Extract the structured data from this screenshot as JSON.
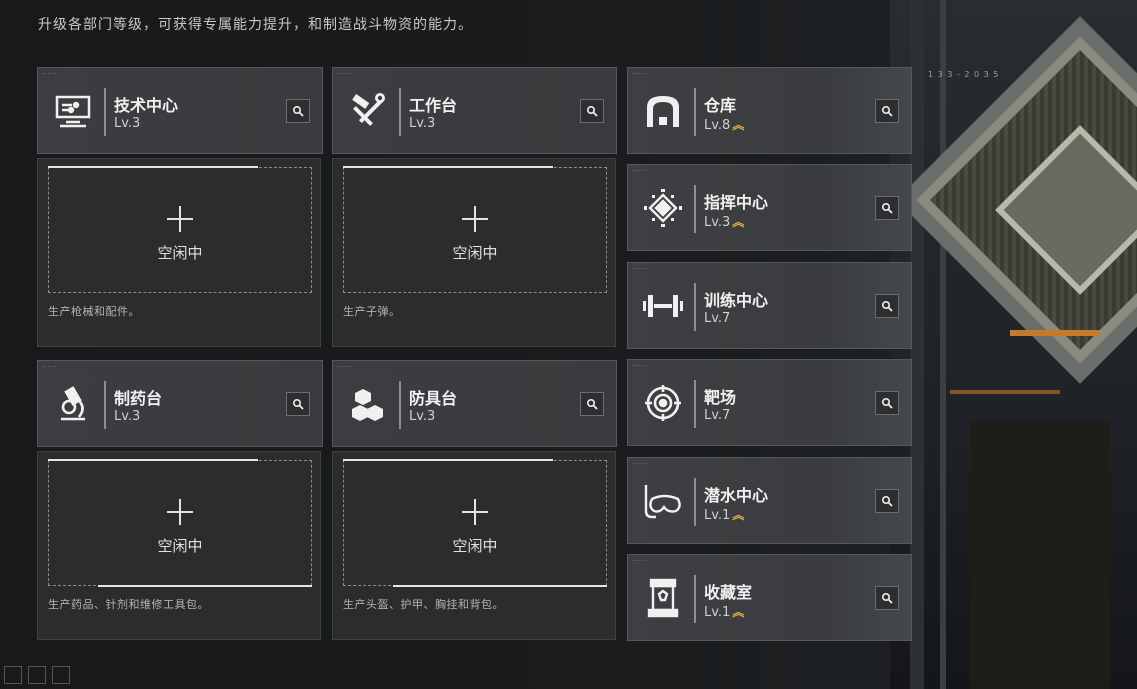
{
  "intro": "升级各部门等级，可获得专属能力提升，和制造战斗物资的能力。",
  "hud_readout": "1 3 3 - 2 0 3 5",
  "left_facilities": [
    {
      "name": "技术中心",
      "level": "Lv.3",
      "icon": "monitor-icon",
      "slot_label": "空闲中",
      "desc": "生产枪械和配件。"
    },
    {
      "name": "工作台",
      "level": "Lv.3",
      "icon": "hammer-wrench-icon",
      "slot_label": "空闲中",
      "desc": "生产子弹。"
    },
    {
      "name": "制药台",
      "level": "Lv.3",
      "icon": "microscope-icon",
      "slot_label": "空闲中",
      "desc": "生产药品、针剂和维修工具包。"
    },
    {
      "name": "防具台",
      "level": "Lv.3",
      "icon": "cubes-icon",
      "slot_label": "空闲中",
      "desc": "生产头盔、护甲、胸挂和背包。"
    }
  ],
  "right_facilities": [
    {
      "name": "仓库",
      "level": "Lv.8",
      "upgradable": true,
      "icon": "warehouse-icon"
    },
    {
      "name": "指挥中心",
      "level": "Lv.3",
      "upgradable": true,
      "icon": "chip-icon"
    },
    {
      "name": "训练中心",
      "level": "Lv.7",
      "upgradable": false,
      "icon": "dumbbell-icon"
    },
    {
      "name": "靶场",
      "level": "Lv.7",
      "upgradable": false,
      "icon": "target-icon"
    },
    {
      "name": "潜水中心",
      "level": "Lv.1",
      "upgradable": true,
      "icon": "diving-mask-icon"
    },
    {
      "name": "收藏室",
      "level": "Lv.1",
      "upgradable": true,
      "icon": "display-case-icon"
    }
  ],
  "upgrade_glyph": "︽",
  "colors": {
    "upgrade_arrow": "#e0b048",
    "panel": "#3b3d40",
    "background": "#17191b"
  }
}
